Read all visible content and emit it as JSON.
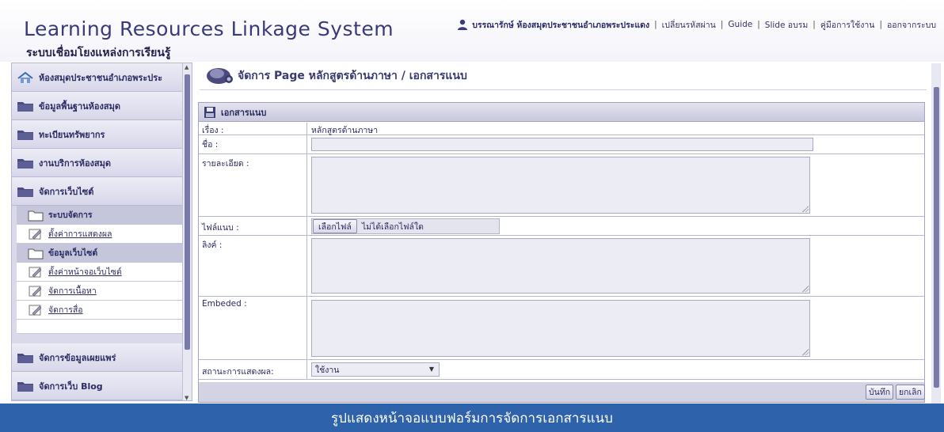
{
  "header": {
    "app_title": "Learning Resources Linkage System",
    "app_subtitle": "ระบบเชื่อมโยงแหล่งการเรียนรู้",
    "user_name": "บรรณารักษ์ ห้องสมุดประชาชนอำเภอพระประแดง",
    "links": [
      "เปลี่ยนรหัสผ่าน",
      "Guide",
      "Slide อบรม",
      "คู่มือการใช้งาน",
      "ออกจากระบบ"
    ]
  },
  "sidebar": {
    "items": [
      {
        "label": "ห้องสมุดประชาชนอำเภอพระประ",
        "icon": "home-icon"
      },
      {
        "label": "ข้อมูลพื้นฐานห้องสมุด",
        "icon": "folder-icon"
      },
      {
        "label": "ทะเบียนทรัพยากร",
        "icon": "folder-icon"
      },
      {
        "label": "งานบริการห้องสมุด",
        "icon": "folder-icon"
      },
      {
        "label": "จัดการเว็บไซต์",
        "icon": "folder-icon"
      }
    ],
    "sub_items": [
      {
        "label": "ระบบจัดการ",
        "header": true
      },
      {
        "label": "ตั้งค่าการแสดงผล",
        "header": false
      },
      {
        "label": "ข้อมูลเว็บไซต์",
        "header": true
      },
      {
        "label": "ตั้งค่าหน้าจอเว็บไซต์",
        "header": false
      },
      {
        "label": "จัดการเนื้อหา",
        "header": false
      },
      {
        "label": "จัดการสื่อ",
        "header": false
      }
    ],
    "bottom_items": [
      {
        "label": "จัดการข้อมูลเผยแพร่",
        "icon": "folder-icon"
      },
      {
        "label": "จัดการเว็บ Blog",
        "icon": "folder-icon"
      }
    ]
  },
  "main": {
    "title": "จัดการ Page หลักสูตรด้านภาษา / เอกสารแนบ",
    "form_title": "เอกสารแนบ",
    "fields": {
      "subject_label": "เรื่อง :",
      "subject_value": "หลักสูตรด้านภาษา",
      "name_label": "ชื่อ :",
      "name_value": "",
      "detail_label": "รายละเอียด :",
      "detail_value": "",
      "file_label": "ไฟล์แนบ :",
      "file_button": "เลือกไฟล์",
      "file_status": "ไม่ได้เลือกไฟล์ใด",
      "link_label": "ลิงค์ :",
      "link_value": "",
      "embed_label": "Embeded :",
      "embed_value": "",
      "status_label": "สถานะการแสดงผล:",
      "status_value": "ใช้งาน"
    },
    "buttons": {
      "save": "บันทึก",
      "cancel": "ยกเลิก"
    }
  },
  "caption": "รูปแสดงหน้าจอแบบฟอร์มการจัดการเอกสารแนบ",
  "colors": {
    "accent": "#2e62aa",
    "panel": "#d9d9ea",
    "text": "#2a2a60"
  }
}
